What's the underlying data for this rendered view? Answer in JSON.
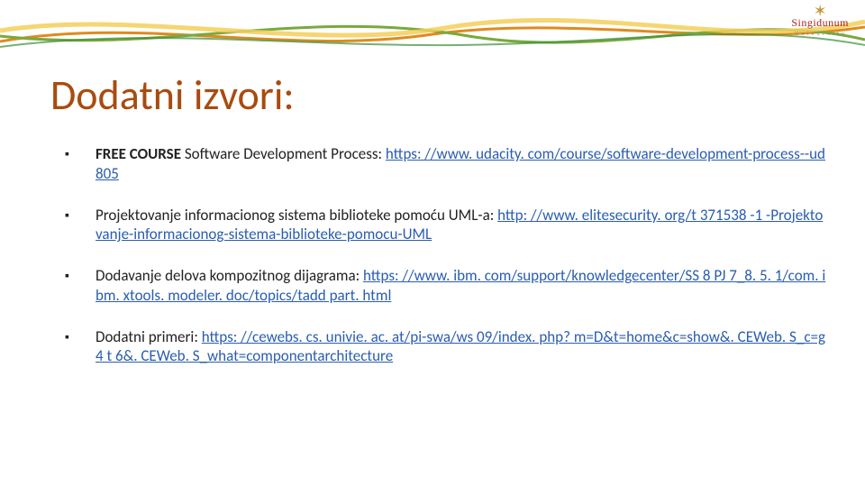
{
  "logo": {
    "name": "Singidunum",
    "sub": "U n i v e r s i t y"
  },
  "title": "Dodatni izvori:",
  "items": [
    {
      "bold": "FREE COURSE",
      "plain": " Software Development Process: ",
      "link": "https: //www. udacity. com/course/software-development-process--ud 805"
    },
    {
      "plain": "Projektovanje informacionog sistema biblioteke pomoću UML-a: ",
      "link": "http: //www. elitesecurity. org/t 371538 -1 -Projektovanje-informacionog-sistema-biblioteke-pomocu-UML"
    },
    {
      "plain": "Dodavanje delova kompozitnog dijagrama: ",
      "link": "https: //www. ibm. com/support/knowledgecenter/SS 8 PJ 7_8. 5. 1/com. ibm. xtools. modeler. doc/topics/tadd part. html"
    },
    {
      "plain": "Dodatni primeri: ",
      "link": "https: //cewebs. cs. univie. ac. at/pi-swa/ws 09/index. php? m=D&t=home&c=show&. CEWeb. S_c=g 4 t 6&. CEWeb. S_what=componentarchitecture"
    }
  ]
}
